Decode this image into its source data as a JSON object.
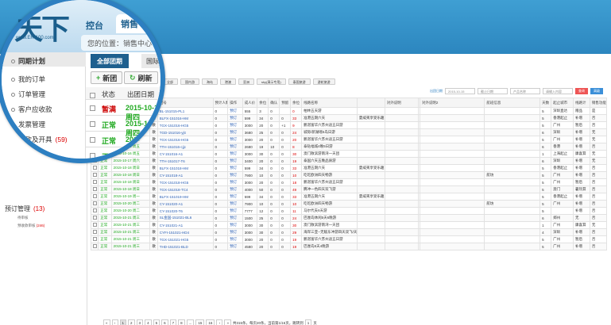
{
  "header": {
    "logo": "天下",
    "logo_sub": "www.ER-100.com",
    "tabs": [
      "控台",
      "销售"
    ],
    "location_label": "您的位置：",
    "location_value": "销售中心",
    "location_tail": "〉"
  },
  "nav": {
    "links": [
      "首页",
      "财务",
      "行政",
      "系统",
      "统计"
    ]
  },
  "user": {
    "name": "sky",
    "links": [
      "消息",
      "帮助",
      "退出",
      "收藏",
      "设置"
    ]
  },
  "sidebar": {
    "items": [
      {
        "label": "同期计划",
        "active": true
      },
      {
        "label": "我的订单"
      },
      {
        "label": "订单管理"
      },
      {
        "label": "客户应收款"
      },
      {
        "label": "发票管理"
      },
      {
        "label": "收款及开具",
        "count": "(59)"
      },
      {
        "label": "预订管理",
        "count": "(13)"
      }
    ],
    "subitems": [
      {
        "label": "待审核",
        "count": ""
      },
      {
        "label": "预收款审核",
        "count": "(246)"
      }
    ]
  },
  "toolbar": {
    "type_tabs": [
      "全部团期",
      "国际游"
    ],
    "new_label": "新团",
    "refresh_label": "刷新"
  },
  "filters": [
    "全部",
    "国内游",
    "海岛",
    "港澳",
    "亚洲",
    "sky(演示专用)",
    "泰国旅游",
    "游轮旅游"
  ],
  "search": {
    "date_label": "出团日期",
    "date_value": "2015-10-15",
    "date_placeholder": "截止日期",
    "product_placeholder": "产品名称",
    "keyword_placeholder": "请输入内容",
    "search_label": "查询",
    "advanced_label": "高级"
  },
  "table": {
    "headers": [
      "",
      "状态",
      "出团日期",
      "",
      "团号",
      "预计人数",
      "操作",
      "成人价",
      "余位",
      "确认",
      "预留",
      "余位",
      "线路名称",
      "",
      "对外说明",
      "",
      "对外说明2",
      "航班信息",
      "天数",
      "起止城市",
      "线路计",
      "销售功能"
    ],
    "rows": [
      {
        "status": "暂满",
        "date": "2015-10-15 周四",
        "d": "散",
        "code": "BL-151015-PL1",
        "n1": "0",
        "op": "预订",
        "price": "555",
        "a": "3",
        "b": "0",
        "c": "",
        "d2": "0",
        "route": "柏林五天游",
        "note": "",
        "note2": "",
        "flight": "",
        "days": "5",
        "city": "深圳直达",
        "s1": "赠品",
        "s2": "是"
      },
      {
        "status": "正常",
        "date": "2015-10-15 周四",
        "d": "散",
        "code": "BLFX-151016-HM",
        "n1": "0",
        "op": "预订",
        "price": "599",
        "a": "34",
        "b": "0",
        "c": "0",
        "d2": "33",
        "route": "准港五期六天",
        "note": "夏威夷享受乐趣",
        "note2": "描绘准港惠多元化度活动式,包人真",
        "flight": "",
        "days": "5",
        "city": "香港起止",
        "s1": "补增",
        "s2": "否"
      },
      {
        "status": "正常",
        "date": "2015-10-15 周四",
        "d": "散",
        "code": "TGX-151016-HG5",
        "n1": "0",
        "op": "预订",
        "price": "3000",
        "a": "20",
        "b": "0",
        "c": "+1",
        "d2": "9",
        "route": "鹏湛富华六苏州迪五日游",
        "note": "",
        "note2": "",
        "flight": "",
        "days": "5",
        "city": "广州",
        "s1": "暂后",
        "s2": "否"
      },
      {
        "status": "正常",
        "date": "2015-10-15 周四",
        "d": "散",
        "code": "TGD-151016-yjit",
        "n1": "0",
        "op": "预订",
        "price": "3680",
        "a": "25",
        "b": "0",
        "c": "0",
        "d2": "24",
        "route": "城际/新湖喀5岛日游",
        "note": "",
        "note2": "",
        "flight": "",
        "days": "6",
        "city": "深圳",
        "s1": "补增",
        "s2": "无"
      },
      {
        "status": "正常",
        "date": "2015-10-16 周五",
        "d": "散",
        "code": "TGX-151016-HG5",
        "n1": "0",
        "op": "预订",
        "price": "3000",
        "a": "20",
        "b": "0",
        "c": "0",
        "d2": "20",
        "route": "鹏湛富华六苏州迪五日游",
        "note": "",
        "note2": "",
        "flight": "",
        "days": "5",
        "city": "广州",
        "s1": "补增",
        "s2": "无"
      },
      {
        "status": "正常",
        "date": "2015-10-16 周五",
        "d": "散",
        "code": "TTH-151016-cjjc",
        "n1": "0",
        "op": "预订",
        "price": "2680",
        "a": "19",
        "b": "10",
        "c": "0",
        "d2": "8",
        "route": "泰钻福城4晚5日游",
        "note": "",
        "note2": "香子源",
        "flight": "",
        "days": "6",
        "city": "香港",
        "s1": "补增",
        "s2": "否"
      },
      {
        "status": "正常",
        "date": "2015-10-16 周五",
        "d": "散",
        "code": "CY-151016-A1",
        "n1": "0",
        "op": "预订",
        "price": "3000",
        "a": "30",
        "b": "0",
        "c": "0",
        "d2": "30",
        "route": "澳门散滨游南湾一天团",
        "note": "",
        "note2": "",
        "flight": "",
        "days": "1",
        "city": "上海起止",
        "s1": "康喜茸",
        "s2": "无"
      },
      {
        "status": "正常",
        "date": "2015-10-17 周六",
        "d": "散",
        "code": "TTH-151017-T6",
        "n1": "0",
        "op": "预订",
        "price": "3400",
        "a": "20",
        "b": "0",
        "c": "0",
        "d2": "19",
        "route": "泰国六天五晚品质游",
        "note": "",
        "note2": "热门国家产品",
        "flight": "",
        "days": "6",
        "city": "深圳",
        "s1": "补增",
        "s2": "无"
      },
      {
        "status": "正常",
        "date": "2015-10-18 周日",
        "d": "散",
        "code": "BLFX-151018-HM",
        "n1": "0",
        "op": "预订",
        "price": "599",
        "a": "34",
        "b": "0",
        "c": "0",
        "d2": "33",
        "route": "准港五期六天",
        "note": "夏威夷享受乐趣",
        "note2": "描绘准港惠多元化度活动式,包人真",
        "flight": "",
        "days": "5",
        "city": "香港起止",
        "s1": "补增",
        "s2": "否"
      },
      {
        "status": "正常",
        "date": "2015-10-18 周日",
        "d": "散",
        "code": "CY-151018-A1",
        "n1": "0",
        "op": "预订",
        "price": "7900",
        "a": "10",
        "b": "0",
        "c": "0",
        "d2": "10",
        "route": "吃吃欧洲四天畅游",
        "note": "",
        "note2": "香港",
        "flight": "航坊",
        "days": "5",
        "city": "广州",
        "s1": "补增",
        "s2": "否"
      },
      {
        "status": "正常",
        "date": "2015-10-18 周日",
        "d": "散",
        "code": "TGX-151018-HG5",
        "n1": "0",
        "op": "预订",
        "price": "3000",
        "a": "20",
        "b": "0",
        "c": "0",
        "d2": "18",
        "route": "鹏湛富华六苏州迪五日游",
        "note": "",
        "note2": "",
        "flight": "",
        "days": "5",
        "city": "广州",
        "s1": "暂后",
        "s2": "否"
      },
      {
        "status": "正常",
        "date": "2015-10-18 周日",
        "d": "散",
        "code": "TGX-151018-TC4",
        "n1": "0",
        "op": "预订",
        "price": "4000",
        "a": "50",
        "b": "0",
        "c": "0",
        "d2": "49",
        "route": "腾冲一色四天双飞游",
        "note": "",
        "note2": "",
        "flight": "",
        "days": "5",
        "city": "澳门",
        "s1": "暑热茸",
        "s2": "否"
      },
      {
        "status": "正常",
        "date": "2015-10-19 周一",
        "d": "散",
        "code": "BLFX-151019-HM",
        "n1": "0",
        "op": "预订",
        "price": "599",
        "a": "34",
        "b": "0",
        "c": "0",
        "d2": "33",
        "route": "准港五期六天",
        "note": "夏威夷享受乐趣",
        "note2": "描绘准港惠多元化度活动式,包人真",
        "flight": "",
        "days": "5",
        "city": "香港起止",
        "s1": "补增",
        "s2": "否"
      },
      {
        "status": "正常",
        "date": "2015-10-20 周二",
        "d": "散",
        "code": "CY-151020-A1",
        "n1": "0",
        "op": "预订",
        "price": "7900",
        "a": "10",
        "b": "0",
        "c": "0",
        "d2": "10",
        "route": "吃吃欧洲四天畅游",
        "note": "",
        "note2": "香港",
        "flight": "航坊",
        "days": "5",
        "city": "广州",
        "s1": "补增",
        "s2": "否"
      },
      {
        "status": "正常",
        "date": "2015-10-20 周二",
        "d": "散",
        "code": "CY-151020-T6",
        "n1": "0",
        "op": "预订",
        "price": "7777",
        "a": "12",
        "b": "0",
        "c": "0",
        "d2": "11",
        "route": "马尔代夫6天游",
        "note": "",
        "note2": "",
        "flight": "",
        "days": "5",
        "city": "",
        "s1": "补增",
        "s2": "否"
      },
      {
        "status": "正常",
        "date": "2015-10-21 周三",
        "d": "散",
        "code": "SL金国-151021-BL6",
        "n1": "0",
        "op": "预订",
        "price": "1500",
        "a": "25",
        "b": "0",
        "c": "0",
        "d2": "24",
        "route": "巴厘岛休闲5天6晚游",
        "note": "",
        "note2": "",
        "flight": "",
        "days": "6",
        "city": "郑州",
        "s1": "无",
        "s2": "否"
      },
      {
        "status": "正常",
        "date": "2015-10-21 周三",
        "d": "散",
        "code": "CY-151021-A1",
        "n1": "0",
        "op": "预订",
        "price": "3000",
        "a": "30",
        "b": "0",
        "c": "0",
        "d2": "30",
        "route": "澳门散滨游南湾一天团",
        "note": "",
        "note2": "",
        "flight": "",
        "days": "1",
        "city": "广州",
        "s1": "康喜茸",
        "s2": "无"
      },
      {
        "status": "正常",
        "date": "2015-10-21 周三",
        "d": "散",
        "code": "CYFI-151021-HD4",
        "n1": "0",
        "op": "预订",
        "price": "3000",
        "a": "30",
        "b": "0",
        "c": "0",
        "d2": "29",
        "route": "海岸三亚--无敌东冲游四天双飞/天超",
        "note": "",
        "note2": "",
        "flight": "",
        "days": "4",
        "city": "深圳",
        "s1": "补增",
        "s2": "否"
      },
      {
        "status": "正常",
        "date": "2015-10-21 周三",
        "d": "散",
        "code": "TGX-151021-HG5",
        "n1": "0",
        "op": "预订",
        "price": "3000",
        "a": "20",
        "b": "0",
        "c": "0",
        "d2": "19",
        "route": "鹏湛富华六苏州迪五日游",
        "note": "",
        "note2": "",
        "flight": "",
        "days": "5",
        "city": "广州",
        "s1": "暂后",
        "s2": "否"
      },
      {
        "status": "正常",
        "date": "2015-10-21 周三",
        "d": "散",
        "code": "THD-151021-BLD",
        "n1": "0",
        "op": "预订",
        "price": "4580",
        "a": "20",
        "b": "0",
        "c": "0",
        "d2": "19",
        "route": "巴厘岛5天4晚游",
        "note": "",
        "note2": "",
        "flight": "",
        "days": "5",
        "city": "广州",
        "s1": "补增",
        "s2": "否"
      }
    ]
  },
  "pager": {
    "pages": [
      "«",
      "‹",
      "1",
      "2",
      "3",
      "4",
      "5",
      "6",
      "7",
      "8",
      "...",
      "15",
      "16",
      "›",
      "»"
    ],
    "summary": "共315条，每页20条，当前第1/16页，跳转到",
    "goto_value": "1",
    "goto_suffix": "页"
  },
  "colors": {
    "accent": "#2d7fc1",
    "status_ok": "#22aa22",
    "status_full": "#cc0000"
  }
}
